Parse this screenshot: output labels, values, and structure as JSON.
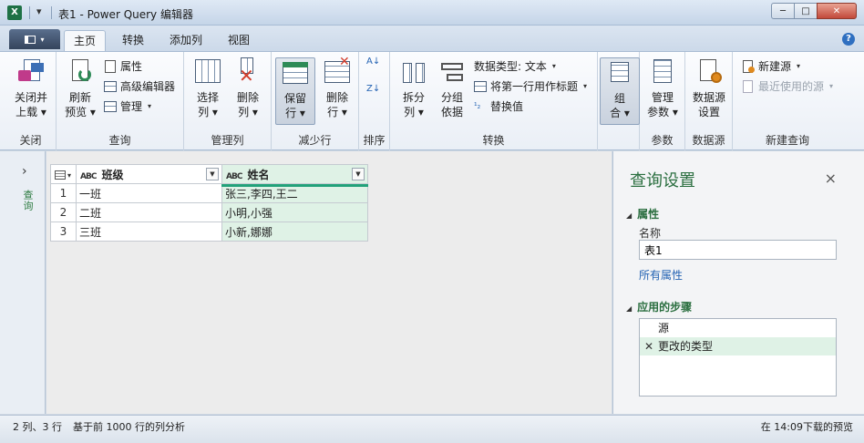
{
  "window": {
    "app_icon_text": "X",
    "title": "表1 - Power Query 编辑器",
    "controls": {
      "minimize": "─",
      "maximize": "□",
      "close": "✕"
    }
  },
  "tabs": [
    {
      "label": "主页",
      "active": true
    },
    {
      "label": "转换",
      "active": false
    },
    {
      "label": "添加列",
      "active": false
    },
    {
      "label": "视图",
      "active": false
    }
  ],
  "ribbon": {
    "close_group": {
      "label": "关闭",
      "close_load_1": "关闭并",
      "close_load_2": "上载 ▾"
    },
    "query_group": {
      "label": "查询",
      "refresh_1": "刷新",
      "refresh_2": "预览 ▾",
      "properties": "属性",
      "advanced_editor": "高级编辑器",
      "manage": "管理"
    },
    "manage_cols_group": {
      "label": "管理列",
      "choose_1": "选择",
      "choose_2": "列 ▾",
      "remove_1": "删除",
      "remove_2": "列 ▾"
    },
    "reduce_rows_group": {
      "label": "减少行",
      "keep_1": "保留",
      "keep_2": "行 ▾",
      "remove_1": "删除",
      "remove_2": "行 ▾"
    },
    "sort_group": {
      "label": "排序"
    },
    "transform_group": {
      "label": "转换",
      "split_1": "拆分",
      "split_2": "列 ▾",
      "group_1": "分组",
      "group_2": "依据",
      "data_type": "数据类型: 文本",
      "first_row_header": "将第一行用作标题",
      "replace_values": "替换值"
    },
    "combine_group": {
      "combine_1": "组",
      "combine_2": "合 ▾"
    },
    "params_group": {
      "label": "参数",
      "manage_1": "管理",
      "manage_2": "参数 ▾"
    },
    "datasource_group": {
      "label": "数据源",
      "settings_1": "数据源",
      "settings_2": "设置"
    },
    "newquery_group": {
      "label": "新建查询",
      "new_source": "新建源",
      "recent_sources": "最近使用的源"
    }
  },
  "leftnav": {
    "expand_arrow": "›",
    "label": "查询"
  },
  "table": {
    "columns": [
      {
        "type": "ABC",
        "name": "班级"
      },
      {
        "type": "ABC",
        "name": "姓名"
      }
    ],
    "rows": [
      {
        "num": "1",
        "c1": "一班",
        "c2": "张三,李四,王二"
      },
      {
        "num": "2",
        "c1": "二班",
        "c2": "小明,小强"
      },
      {
        "num": "3",
        "c1": "三班",
        "c2": "小新,娜娜"
      }
    ]
  },
  "settings": {
    "title": "查询设置",
    "close": "×",
    "properties_head": "属性",
    "name_label": "名称",
    "name_value": "表1",
    "all_properties": "所有属性",
    "steps_head": "应用的步骤",
    "steps": [
      {
        "label": "源",
        "selected": false
      },
      {
        "label": "更改的类型",
        "selected": true
      }
    ]
  },
  "status": {
    "dims": "2 列、3 行",
    "profiling": "基于前 1000 行的列分析",
    "preview_time": "在 14:09下载的预览"
  },
  "colors": {
    "accent_green": "#2a6e3f",
    "selection_green": "#dff2e6",
    "header_accent": "#22a27a",
    "link_blue": "#2463b3"
  }
}
